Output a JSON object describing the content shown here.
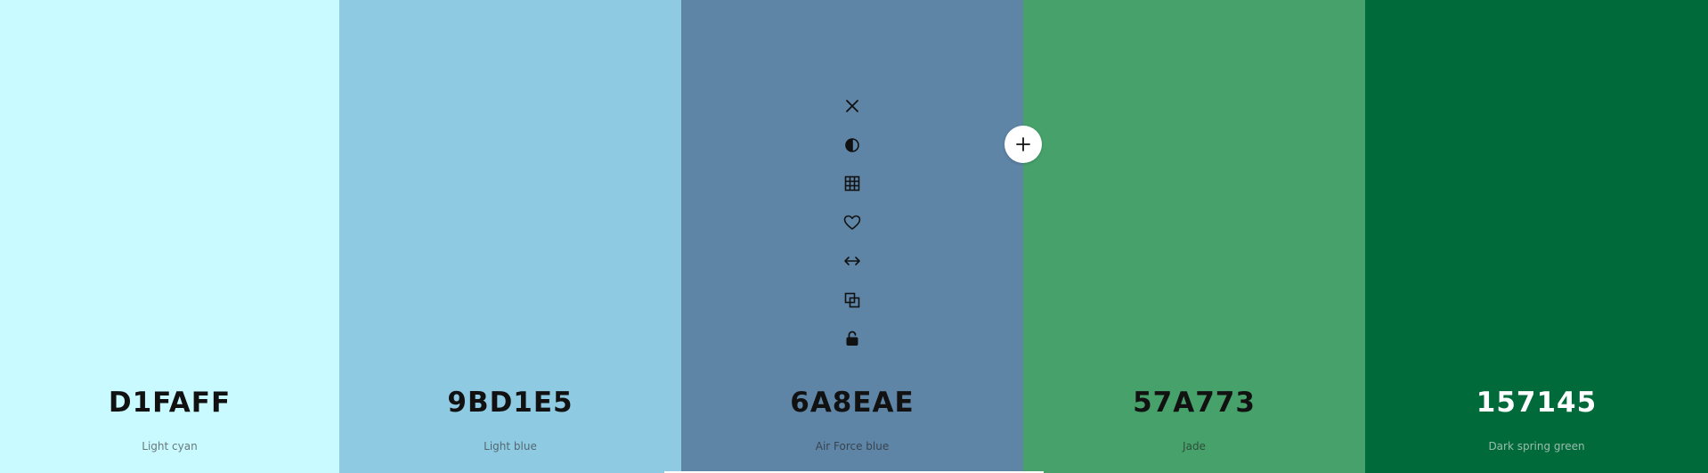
{
  "swatches": [
    {
      "hex": "D1FAFF",
      "name": "Light cyan",
      "color": "#C8FAFF",
      "text_color": "#111111",
      "name_color": "#333333"
    },
    {
      "hex": "9BD1E5",
      "name": "Light blue",
      "color": "#8ECBE3",
      "text_color": "#111111",
      "name_color": "#333333"
    },
    {
      "hex": "6A8EAE",
      "name": "Air Force blue",
      "color": "#5E84A6",
      "text_color": "#111111",
      "name_color": "#222222"
    },
    {
      "hex": "57A773",
      "name": "Jade",
      "color": "#47A16B",
      "text_color": "#111111",
      "name_color": "#222222"
    },
    {
      "hex": "157145",
      "name": "Dark spring green",
      "color": "#016A3B",
      "text_color": "#FFFFFF",
      "name_color": "#E8E8E8"
    }
  ],
  "toolbar": {
    "icons": [
      "close-icon",
      "contrast-icon",
      "grid-icon",
      "heart-icon",
      "drag-horizontal-icon",
      "copy-icon",
      "unlock-icon"
    ]
  },
  "add_button": {
    "icon": "plus-icon"
  }
}
